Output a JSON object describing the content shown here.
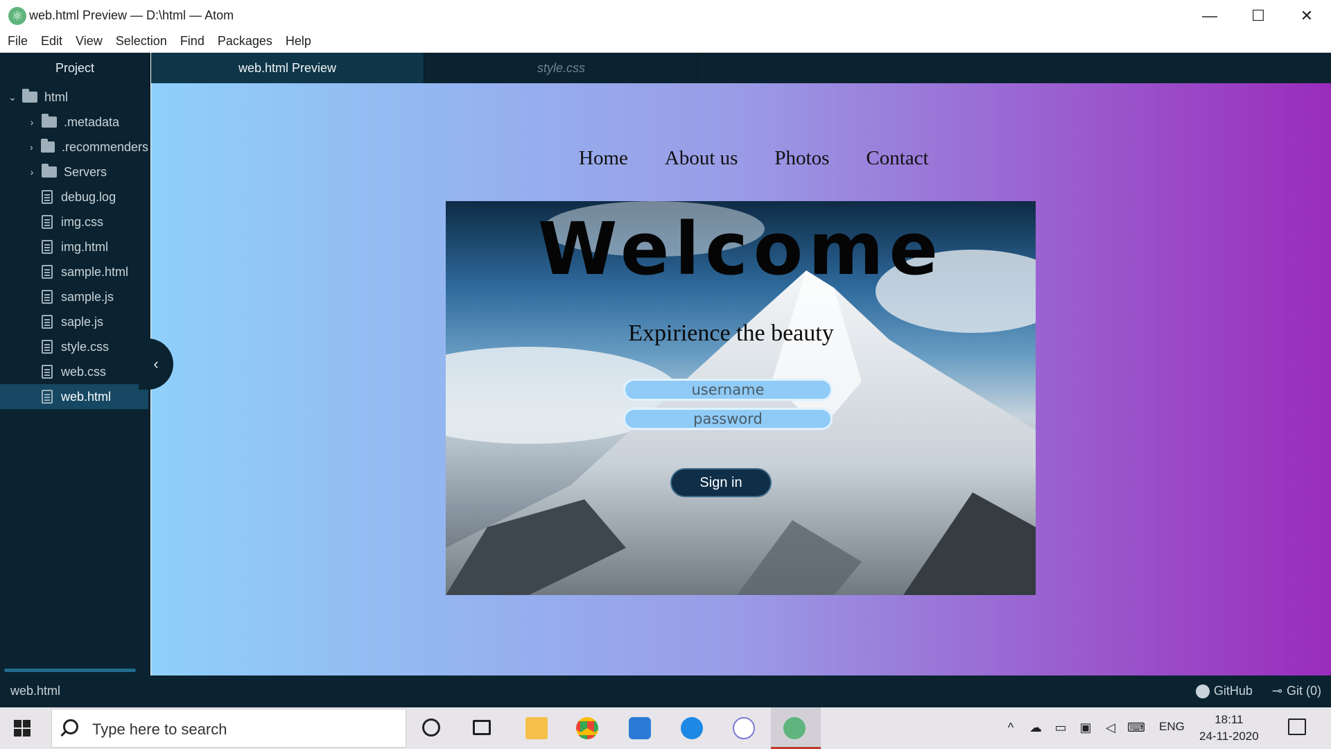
{
  "window": {
    "title": "web.html Preview — D:\\html — Atom",
    "minimize": "—",
    "maximize": "☐",
    "close": "✕"
  },
  "menu": [
    "File",
    "Edit",
    "View",
    "Selection",
    "Find",
    "Packages",
    "Help"
  ],
  "sidebar": {
    "header": "Project",
    "items": [
      {
        "label": "html",
        "type": "folder",
        "expanded": true
      },
      {
        "label": ".metadata",
        "type": "folder",
        "expanded": false
      },
      {
        "label": ".recommenders",
        "type": "folder",
        "expanded": false
      },
      {
        "label": "Servers",
        "type": "folder",
        "expanded": false
      },
      {
        "label": "debug.log",
        "type": "file"
      },
      {
        "label": "img.css",
        "type": "file"
      },
      {
        "label": "img.html",
        "type": "file"
      },
      {
        "label": "sample.html",
        "type": "file"
      },
      {
        "label": "sample.js",
        "type": "file"
      },
      {
        "label": "saple.js",
        "type": "file"
      },
      {
        "label": "style.css",
        "type": "file"
      },
      {
        "label": "web.css",
        "type": "file"
      },
      {
        "label": "web.html",
        "type": "file",
        "selected": true
      }
    ]
  },
  "tabs": [
    {
      "label": "web.html Preview",
      "active": true
    },
    {
      "label": "style.css",
      "active": false
    }
  ],
  "preview": {
    "nav": [
      "Home",
      "About us",
      "Photos",
      "Contact"
    ],
    "hero_title": "Welcome",
    "hero_subtitle": "Expirience the beauty",
    "username_placeholder": "username",
    "password_placeholder": "password",
    "signin_label": "Sign in",
    "gradient": [
      "#8fd0fb",
      "#9a2cbc"
    ]
  },
  "statusbar": {
    "file": "web.html",
    "github": "GitHub",
    "git": "Git (0)"
  },
  "taskbar": {
    "search_placeholder": "Type here to search",
    "language": "ENG",
    "time": "18:11",
    "date": "24-11-2020"
  }
}
